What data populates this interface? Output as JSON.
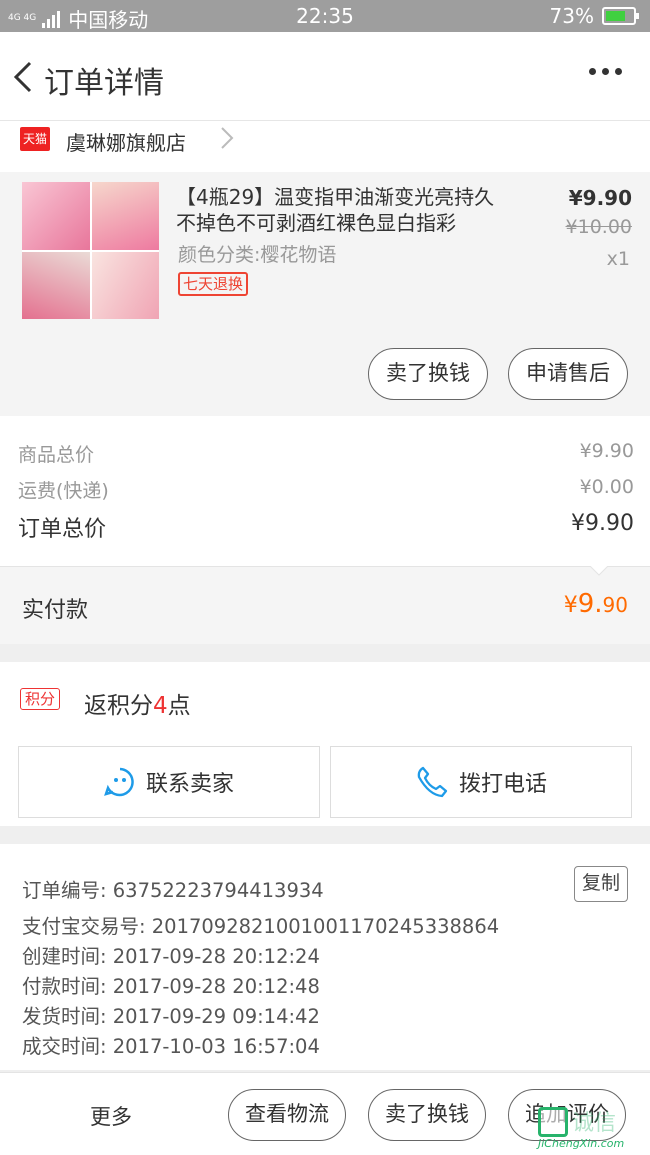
{
  "status_bar": {
    "net": "4G 4G",
    "carrier": "中国移动",
    "time": "22:35",
    "battery": "73%",
    "battery_level": 0.73
  },
  "header": {
    "title": "订单详情"
  },
  "store": {
    "logo_text": "天猫",
    "name": "虞琳娜旗舰店"
  },
  "product": {
    "title": "【4瓶29】温变指甲油渐变光亮持久不掉色不可剥酒红裸色显白指彩",
    "spec": "颜色分类:樱花物语",
    "tag": "七天退换",
    "price": "¥9.90",
    "original_price": "¥10.00",
    "quantity": "x1",
    "btn_resell": "卖了换钱",
    "btn_aftersale": "申请售后"
  },
  "summary": {
    "goods_label": "商品总价",
    "goods_value": "¥9.90",
    "shipping_label": "运费(快递)",
    "shipping_value": "¥0.00",
    "total_label": "订单总价",
    "total_value": "¥9.90",
    "paid_label": "实付款",
    "paid_currency": "¥",
    "paid_int": "9.",
    "paid_dec": "90"
  },
  "points": {
    "badge": "积分",
    "text_prefix": "返积分",
    "value": "4",
    "text_suffix": "点",
    "contact_seller": "联系卖家",
    "call_phone": "拨打电话"
  },
  "order_info": {
    "copy": "复制",
    "rows": [
      "订单编号: 63752223794413934",
      "支付宝交易号: 2017092821001001170245338864",
      "创建时间: 2017-09-28 20:12:24",
      "付款时间: 2017-09-28 20:12:48",
      "发货时间: 2017-09-29 09:14:42",
      "成交时间: 2017-10-03 16:57:04"
    ]
  },
  "bottom_bar": {
    "more": "更多",
    "logistics": "查看物流",
    "resell": "卖了换钱",
    "review": "追加评价"
  },
  "watermark": {
    "text": "诚信",
    "url": "JiChengXin.com"
  },
  "colors": {
    "accent_orange": "#ff6a00",
    "tag_red": "#e43333",
    "icon_blue": "#1e9be8"
  },
  "icons": [
    "back-chevron-icon",
    "more-dots-icon",
    "tmall-logo-icon",
    "chevron-right-icon",
    "chat-smile-icon",
    "phone-icon"
  ]
}
